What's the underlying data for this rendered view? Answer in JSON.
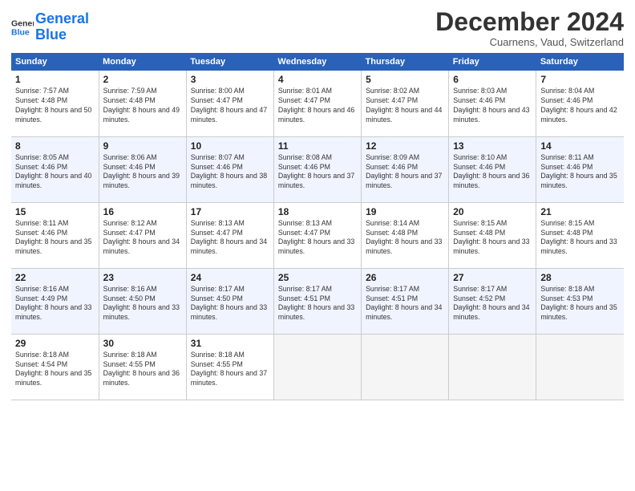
{
  "header": {
    "logo_line1": "General",
    "logo_line2": "Blue",
    "month_title": "December 2024",
    "subtitle": "Cuarnens, Vaud, Switzerland"
  },
  "weekdays": [
    "Sunday",
    "Monday",
    "Tuesday",
    "Wednesday",
    "Thursday",
    "Friday",
    "Saturday"
  ],
  "weeks": [
    [
      {
        "day": "1",
        "sunrise": "7:57 AM",
        "sunset": "4:48 PM",
        "daylight": "8 hours and 50 minutes."
      },
      {
        "day": "2",
        "sunrise": "7:59 AM",
        "sunset": "4:48 PM",
        "daylight": "8 hours and 49 minutes."
      },
      {
        "day": "3",
        "sunrise": "8:00 AM",
        "sunset": "4:47 PM",
        "daylight": "8 hours and 47 minutes."
      },
      {
        "day": "4",
        "sunrise": "8:01 AM",
        "sunset": "4:47 PM",
        "daylight": "8 hours and 46 minutes."
      },
      {
        "day": "5",
        "sunrise": "8:02 AM",
        "sunset": "4:47 PM",
        "daylight": "8 hours and 44 minutes."
      },
      {
        "day": "6",
        "sunrise": "8:03 AM",
        "sunset": "4:46 PM",
        "daylight": "8 hours and 43 minutes."
      },
      {
        "day": "7",
        "sunrise": "8:04 AM",
        "sunset": "4:46 PM",
        "daylight": "8 hours and 42 minutes."
      }
    ],
    [
      {
        "day": "8",
        "sunrise": "8:05 AM",
        "sunset": "4:46 PM",
        "daylight": "8 hours and 40 minutes."
      },
      {
        "day": "9",
        "sunrise": "8:06 AM",
        "sunset": "4:46 PM",
        "daylight": "8 hours and 39 minutes."
      },
      {
        "day": "10",
        "sunrise": "8:07 AM",
        "sunset": "4:46 PM",
        "daylight": "8 hours and 38 minutes."
      },
      {
        "day": "11",
        "sunrise": "8:08 AM",
        "sunset": "4:46 PM",
        "daylight": "8 hours and 37 minutes."
      },
      {
        "day": "12",
        "sunrise": "8:09 AM",
        "sunset": "4:46 PM",
        "daylight": "8 hours and 37 minutes."
      },
      {
        "day": "13",
        "sunrise": "8:10 AM",
        "sunset": "4:46 PM",
        "daylight": "8 hours and 36 minutes."
      },
      {
        "day": "14",
        "sunrise": "8:11 AM",
        "sunset": "4:46 PM",
        "daylight": "8 hours and 35 minutes."
      }
    ],
    [
      {
        "day": "15",
        "sunrise": "8:11 AM",
        "sunset": "4:46 PM",
        "daylight": "8 hours and 35 minutes."
      },
      {
        "day": "16",
        "sunrise": "8:12 AM",
        "sunset": "4:47 PM",
        "daylight": "8 hours and 34 minutes."
      },
      {
        "day": "17",
        "sunrise": "8:13 AM",
        "sunset": "4:47 PM",
        "daylight": "8 hours and 34 minutes."
      },
      {
        "day": "18",
        "sunrise": "8:13 AM",
        "sunset": "4:47 PM",
        "daylight": "8 hours and 33 minutes."
      },
      {
        "day": "19",
        "sunrise": "8:14 AM",
        "sunset": "4:48 PM",
        "daylight": "8 hours and 33 minutes."
      },
      {
        "day": "20",
        "sunrise": "8:15 AM",
        "sunset": "4:48 PM",
        "daylight": "8 hours and 33 minutes."
      },
      {
        "day": "21",
        "sunrise": "8:15 AM",
        "sunset": "4:48 PM",
        "daylight": "8 hours and 33 minutes."
      }
    ],
    [
      {
        "day": "22",
        "sunrise": "8:16 AM",
        "sunset": "4:49 PM",
        "daylight": "8 hours and 33 minutes."
      },
      {
        "day": "23",
        "sunrise": "8:16 AM",
        "sunset": "4:50 PM",
        "daylight": "8 hours and 33 minutes."
      },
      {
        "day": "24",
        "sunrise": "8:17 AM",
        "sunset": "4:50 PM",
        "daylight": "8 hours and 33 minutes."
      },
      {
        "day": "25",
        "sunrise": "8:17 AM",
        "sunset": "4:51 PM",
        "daylight": "8 hours and 33 minutes."
      },
      {
        "day": "26",
        "sunrise": "8:17 AM",
        "sunset": "4:51 PM",
        "daylight": "8 hours and 34 minutes."
      },
      {
        "day": "27",
        "sunrise": "8:17 AM",
        "sunset": "4:52 PM",
        "daylight": "8 hours and 34 minutes."
      },
      {
        "day": "28",
        "sunrise": "8:18 AM",
        "sunset": "4:53 PM",
        "daylight": "8 hours and 35 minutes."
      }
    ],
    [
      {
        "day": "29",
        "sunrise": "8:18 AM",
        "sunset": "4:54 PM",
        "daylight": "8 hours and 35 minutes."
      },
      {
        "day": "30",
        "sunrise": "8:18 AM",
        "sunset": "4:55 PM",
        "daylight": "8 hours and 36 minutes."
      },
      {
        "day": "31",
        "sunrise": "8:18 AM",
        "sunset": "4:55 PM",
        "daylight": "8 hours and 37 minutes."
      },
      null,
      null,
      null,
      null
    ]
  ]
}
